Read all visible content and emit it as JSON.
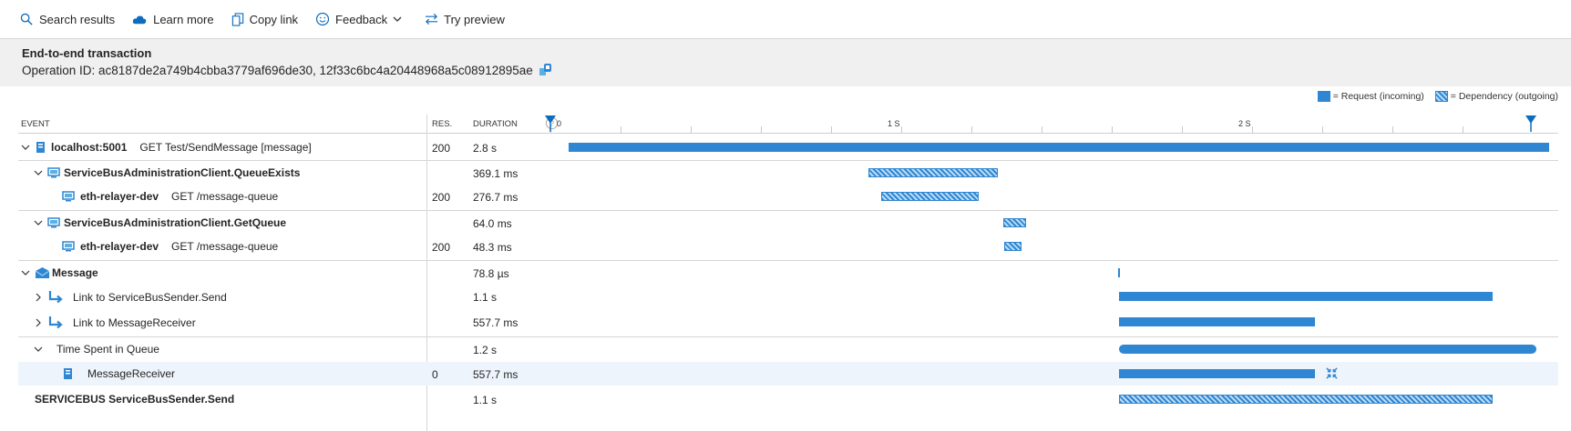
{
  "toolbar": {
    "search_label": "Search results",
    "learn_label": "Learn more",
    "copy_label": "Copy link",
    "feedback_label": "Feedback",
    "preview_label": "Try preview"
  },
  "header": {
    "title": "End-to-end transaction",
    "operation_line": "Operation ID: ac8187de2a749b4cbba3779af696de30, 12f33c6bc4a20448968a5c08912895ae"
  },
  "legend": {
    "request": "= Request (incoming)",
    "dependency": "= Dependency (outgoing)"
  },
  "columns": {
    "event": "EVENT",
    "res": "RES.",
    "duration": "DURATION"
  },
  "timeline": {
    "ticks": [
      "0",
      "1 S",
      "2 S"
    ],
    "total_seconds": 2.8
  },
  "colors": {
    "request": "#2f86d2",
    "dependency_bg": "#bcdcf5",
    "header_bg": "#f0f0f0"
  },
  "rows": [
    {
      "name": "localhost:5001",
      "detail": "GET Test/SendMessage [message]",
      "res": "200",
      "duration": "2.8 s"
    },
    {
      "name": "ServiceBusAdministrationClient.QueueExists",
      "detail": "",
      "res": "",
      "duration": "369.1 ms"
    },
    {
      "name": "eth-relayer-dev",
      "detail": "GET /message-queue",
      "res": "200",
      "duration": "276.7 ms"
    },
    {
      "name": "ServiceBusAdministrationClient.GetQueue",
      "detail": "",
      "res": "",
      "duration": "64.0 ms"
    },
    {
      "name": "eth-relayer-dev",
      "detail": "GET /message-queue",
      "res": "200",
      "duration": "48.3 ms"
    },
    {
      "name": "Message",
      "detail": "",
      "res": "",
      "duration": "78.8 µs"
    },
    {
      "name": "Link to ServiceBusSender.Send",
      "detail": "",
      "res": "",
      "duration": "1.1 s"
    },
    {
      "name": "Link to MessageReceiver",
      "detail": "",
      "res": "",
      "duration": "557.7 ms"
    },
    {
      "name": "Time Spent in Queue",
      "detail": "",
      "res": "",
      "duration": "1.2 s"
    },
    {
      "name": "MessageReceiver",
      "detail": "",
      "res": "0",
      "duration": "557.7 ms"
    },
    {
      "name": "SERVICEBUS ServiceBusSender.Send",
      "detail": "",
      "res": "",
      "duration": "1.1 s"
    }
  ]
}
